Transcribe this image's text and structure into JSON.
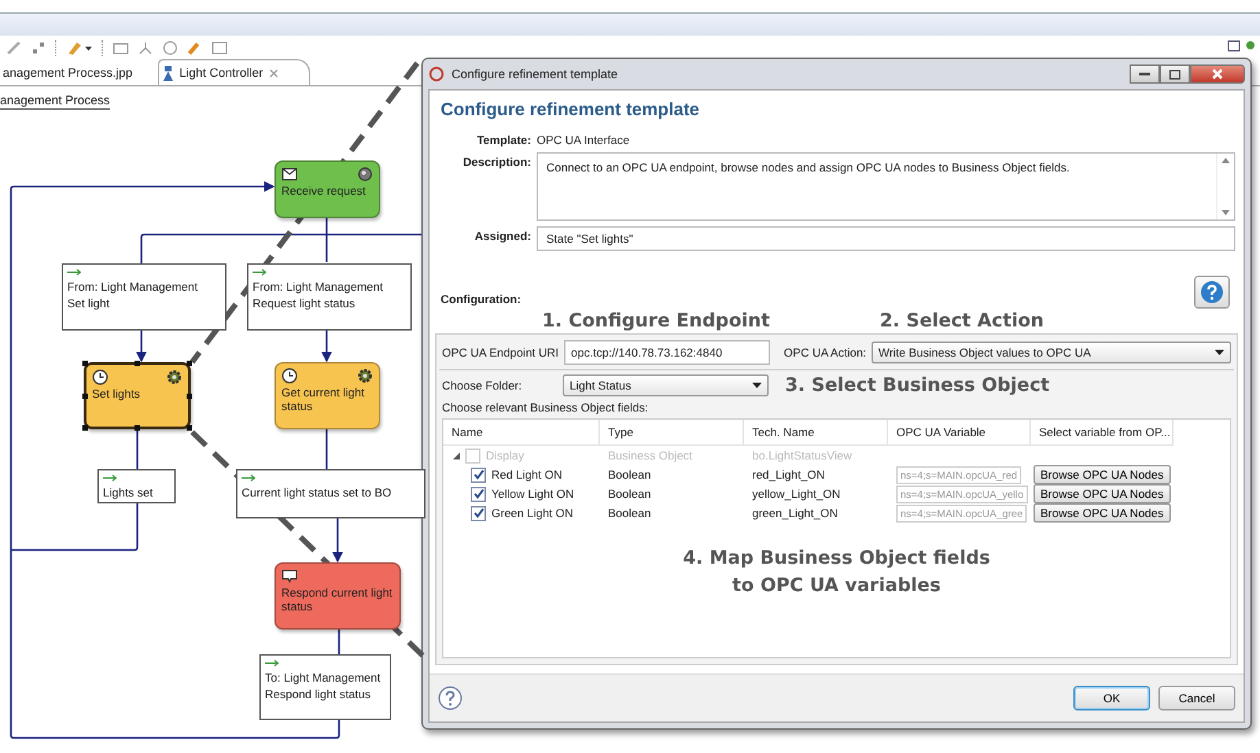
{
  "editor_tabs": [
    {
      "label": "anagement Process.jpp",
      "selected": false
    },
    {
      "label": "Light Controller",
      "selected": true
    }
  ],
  "breadcrumb": "anagement Process",
  "diagram": {
    "nodes": [
      {
        "kind": "receive",
        "label": "Receive request",
        "color": "#6fbf4c"
      },
      {
        "kind": "message",
        "lines": [
          "From: Light Management",
          "Set light"
        ]
      },
      {
        "kind": "message",
        "lines": [
          "From: Light Management",
          "Request light status"
        ]
      },
      {
        "kind": "task",
        "label": "Set lights",
        "color": "#f8c450",
        "selected": true
      },
      {
        "kind": "task",
        "label": "Get current light status",
        "color": "#f8c450",
        "selected": false
      },
      {
        "kind": "message",
        "lines": [
          "Lights set"
        ]
      },
      {
        "kind": "message",
        "lines": [
          "Current light status set to BO"
        ]
      },
      {
        "kind": "send",
        "label": "Respond current light status",
        "color": "#ee6a5c"
      },
      {
        "kind": "message",
        "lines": [
          "To: Light Management",
          "Respond light status"
        ]
      }
    ]
  },
  "dialog": {
    "title": "Configure refinement template",
    "heading": "Configure refinement template",
    "template_label": "Template:",
    "template": "OPC UA Interface",
    "description_label": "Description:",
    "description": "Connect to an OPC UA endpoint, browse nodes and assign OPC UA nodes to Business Object fields.",
    "assigned_label": "Assigned:",
    "assigned": "State \"Set lights\"",
    "configuration_label": "Configuration:",
    "endpoint_label": "OPC UA Endpoint URI",
    "endpoint": "opc.tcp://140.78.73.162:4840",
    "action_label": "OPC UA Action:",
    "action": "Write Business Object values to OPC UA",
    "folder_label": "Choose Folder:",
    "folder": "Light Status",
    "fields_label": "Choose relevant Business Object fields:",
    "columns": [
      "Name",
      "Type",
      "Tech. Name",
      "OPC UA Variable",
      "Select variable from OP..."
    ],
    "rows": [
      {
        "name": "Display",
        "type": "Business Object",
        "tech_name": "bo.LightStatusView",
        "checked": false,
        "disabled": true,
        "expanded": true,
        "children": [
          {
            "name": "Red Light ON",
            "type": "Boolean",
            "tech_name": "red_Light_ON",
            "variable": "ns=4;s=MAIN.opcUA_red",
            "button": "Browse OPC UA Nodes",
            "checked": true,
            "disabled": false
          },
          {
            "name": "Yellow Light ON",
            "type": "Boolean",
            "tech_name": "yellow_Light_ON",
            "variable": "ns=4;s=MAIN.opcUA_yello",
            "button": "Browse OPC UA Nodes",
            "checked": true,
            "disabled": false
          },
          {
            "name": "Green Light ON",
            "type": "Boolean",
            "tech_name": "green_Light_ON",
            "variable": "ns=4;s=MAIN.opcUA_gree",
            "button": "Browse OPC UA Nodes",
            "checked": true,
            "disabled": false
          }
        ]
      }
    ],
    "buttons": [
      {
        "label": "OK",
        "selected": true
      },
      {
        "label": "Cancel",
        "selected": false
      }
    ]
  },
  "annotations": [
    "1. Configure Endpoint",
    "2. Select Action",
    "3. Select Business Object",
    "4. Map Business Object fields\nto OPC UA variables"
  ]
}
